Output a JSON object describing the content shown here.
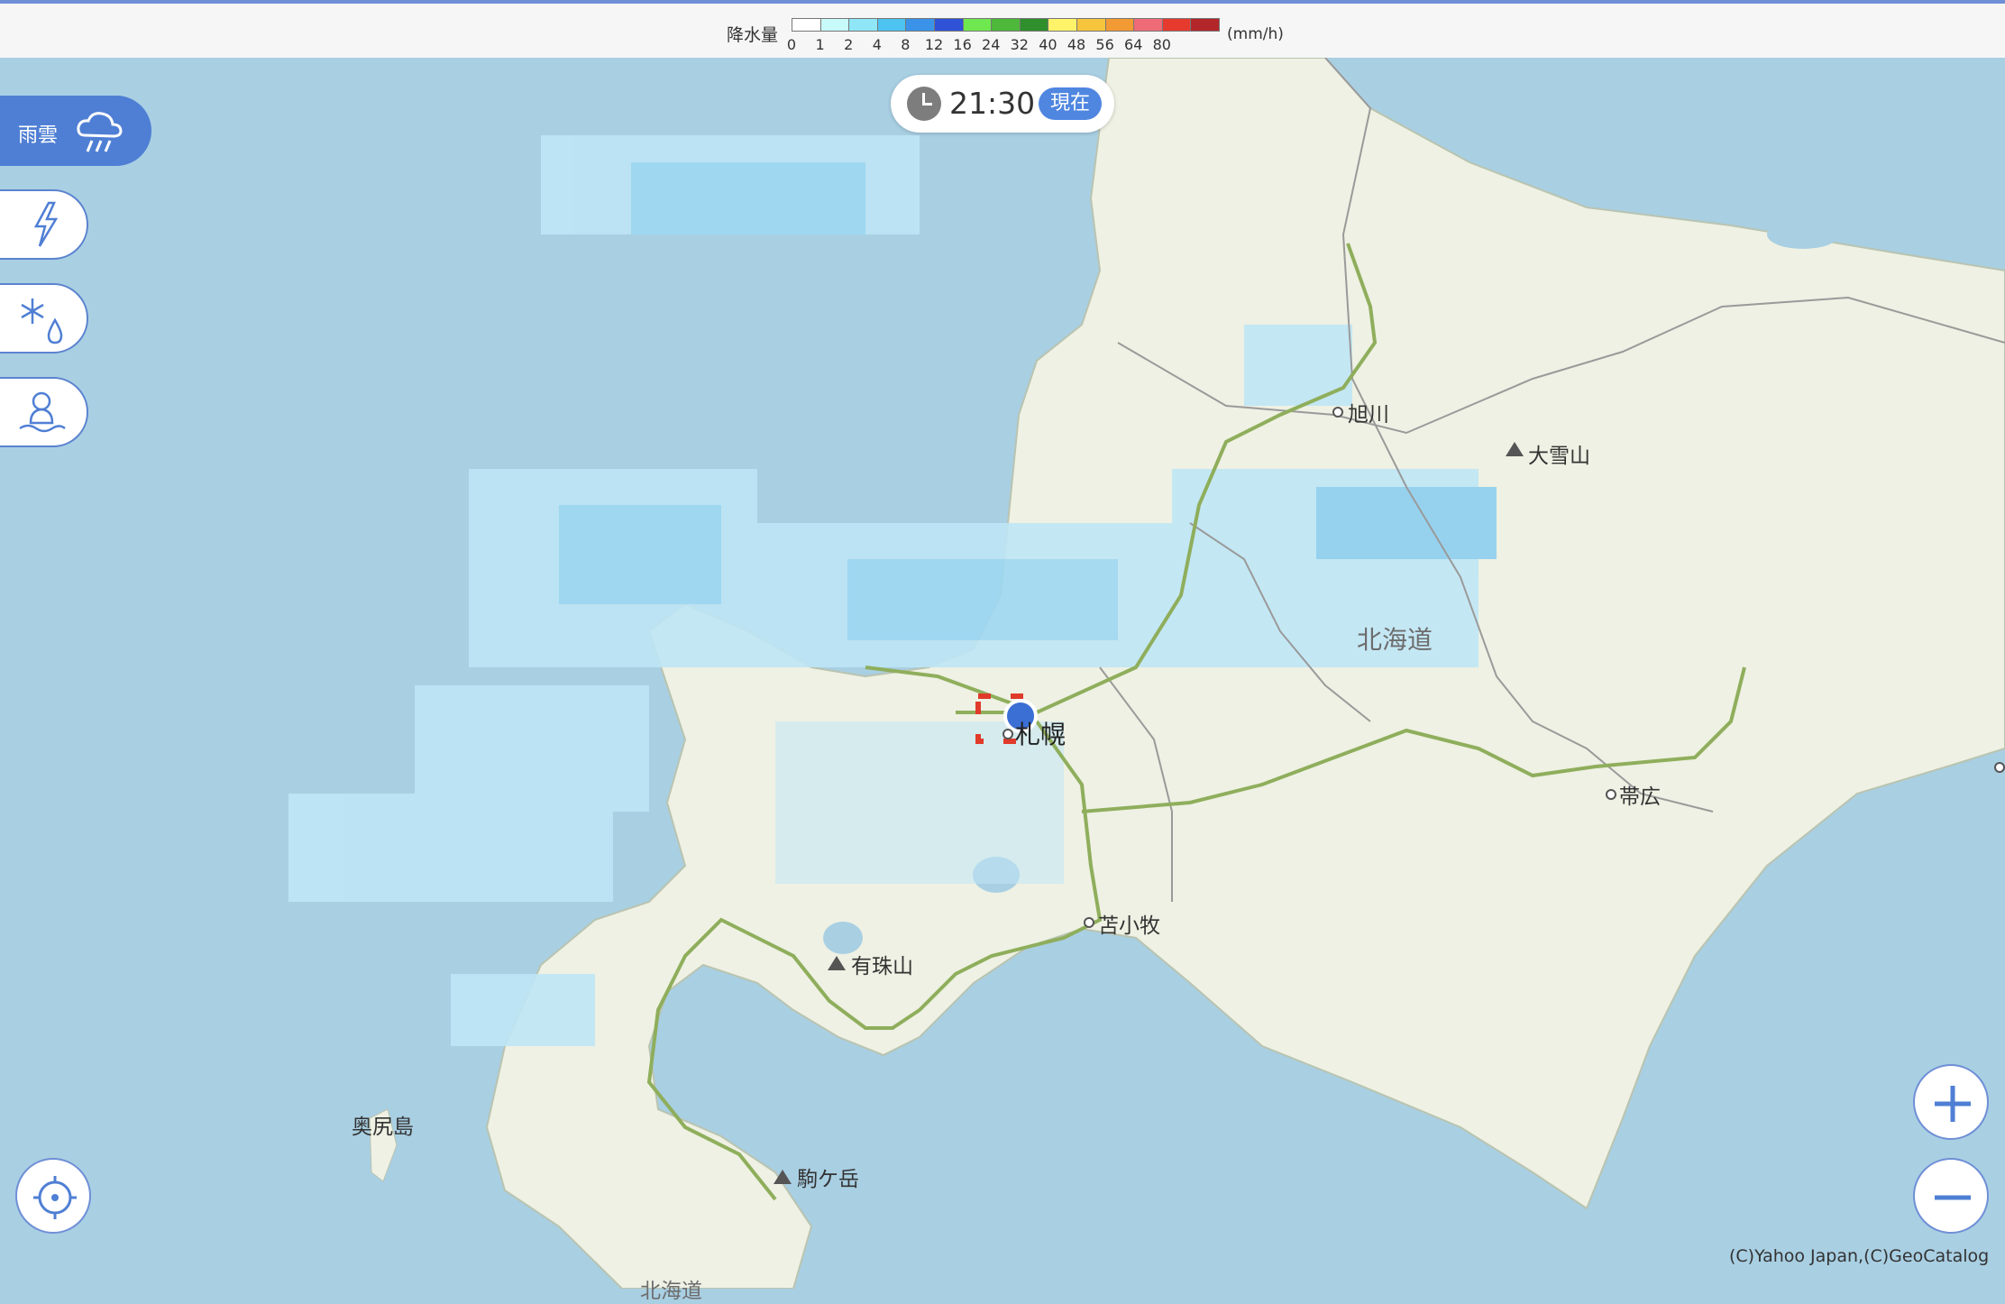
{
  "legend": {
    "title": "降水量",
    "unit": "(mm/h)",
    "colors": [
      "#ffffff",
      "#c8fafa",
      "#8ee6f7",
      "#4cc3f0",
      "#3a93e8",
      "#2f52d6",
      "#6ee84e",
      "#4db83a",
      "#2f8f2c",
      "#fff36a",
      "#f6c53d",
      "#f29a34",
      "#ee6b77",
      "#e63a2f",
      "#b3262a"
    ],
    "labels": [
      "0",
      "1",
      "2",
      "4",
      "8",
      "12",
      "16",
      "24",
      "32",
      "40",
      "48",
      "56",
      "64",
      "80"
    ]
  },
  "time": {
    "value": "21:30",
    "badge": "現在"
  },
  "sidebar": {
    "active_label": "雨雲"
  },
  "places": {
    "asahikawa": "旭川",
    "taisetsuzan": "大雪山",
    "hokkaido": "北海道",
    "sapporo": "札幌",
    "obihiro": "帯広",
    "tomakomai": "苫小牧",
    "usuzan": "有珠山",
    "okushiri": "奥尻島",
    "komagatake": "駒ケ岳",
    "hokkaido_bottom": "北海道"
  },
  "copyright": "(C)Yahoo Japan,(C)GeoCatalog",
  "icons": {
    "rain": "rain-cloud-icon",
    "lightning": "lightning-icon",
    "snow": "snow-icon",
    "snowman": "snowman-icon",
    "clock": "clock-icon",
    "locate": "crosshair-icon",
    "zoom_in": "plus-icon",
    "zoom_out": "minus-icon"
  }
}
